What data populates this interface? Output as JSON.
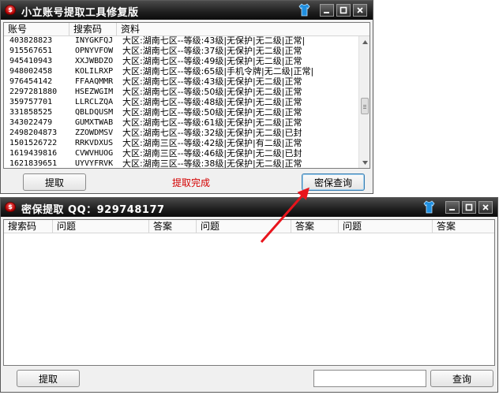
{
  "window1": {
    "title": "小立账号提取工具修复版",
    "columns": [
      "账号",
      "搜索码",
      "资料"
    ],
    "rows": [
      {
        "account": "403828823",
        "code": "INYGKFQJ",
        "info": "大区:湖南七区--等级:43级|无保护|无二级|正常|"
      },
      {
        "account": "915567651",
        "code": "OPNYVFOW",
        "info": "大区:湖南七区--等级:37级|无保护|无二级|正常"
      },
      {
        "account": "945410943",
        "code": "XXJWBDZO",
        "info": "大区:湖南七区--等级:49级|无保护|无二级|正常"
      },
      {
        "account": "948002458",
        "code": "KOLILRXP",
        "info": "大区:湖南七区--等级:65级|手机令牌|无二级|正常|"
      },
      {
        "account": "976454142",
        "code": "FFAAQMMR",
        "info": "大区:湖南七区--等级:43级|无保护|无二级|正常"
      },
      {
        "account": "2297281880",
        "code": "HSEZWGIM",
        "info": "大区:湖南七区--等级:50级|无保护|无二级|正常"
      },
      {
        "account": "359757701",
        "code": "LLRCLZQA",
        "info": "大区:湖南七区--等级:48级|无保护|无二级|正常"
      },
      {
        "account": "331858525",
        "code": "QBLDQUSM",
        "info": "大区:湖南七区--等级:50级|无保护|无二级|正常"
      },
      {
        "account": "343022479",
        "code": "GUMXTWAB",
        "info": "大区:湖南七区--等级:61级|无保护|无二级|正常"
      },
      {
        "account": "2498204873",
        "code": "ZZOWDMSV",
        "info": "大区:湖南七区--等级:32级|无保护|无二级|已封"
      },
      {
        "account": "1501526722",
        "code": "RRKVDXUS",
        "info": "大区:湖南三区--等级:42级|无保护|有二级|正常"
      },
      {
        "account": "1619439816",
        "code": "CVWVHUOG",
        "info": "大区:湖南三区--等级:46级|无保护|无二级|已封"
      },
      {
        "account": "1621839651",
        "code": "UYVYFRVK",
        "info": "大区:湖南三区--等级:38级|无保护|无二级|正常"
      }
    ],
    "extract_button": "提取",
    "status": "提取完成",
    "query_button": "密保查询"
  },
  "window2": {
    "title": "密保提取 QQ：929748177",
    "columns": [
      "搜索码",
      "问题",
      "答案",
      "问题",
      "答案",
      "问题",
      "答案"
    ],
    "extract_button": "提取",
    "search_value": "",
    "query_button": "查询"
  },
  "icons": {
    "app": "app-logo-icon",
    "skin": "skin-shirt-icon",
    "minimize": "minimize-icon",
    "maximize": "maximize-icon",
    "close": "close-icon"
  },
  "colors": {
    "titlebar": "#1e1e1e",
    "status_text": "#d40000",
    "annotation_arrow": "#e8141c",
    "skin_icon": "#1f8fe0"
  }
}
